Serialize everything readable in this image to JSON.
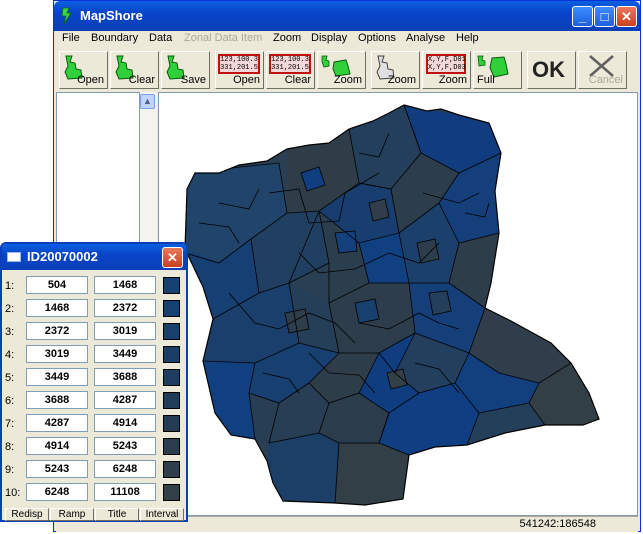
{
  "window": {
    "title": "MapShore"
  },
  "menu": [
    "File",
    "Boundary",
    "Data",
    "Zonal Data Item",
    "Zoom",
    "Display",
    "Options",
    "Analyse",
    "Help"
  ],
  "menu_disabled": [
    "Zonal Data Item"
  ],
  "toolbar": {
    "boundary_open": "Open",
    "boundary_clear": "Clear",
    "boundary_save": "Save",
    "data_open": "Open",
    "data_clear": "Clear",
    "zoom": "Zoom",
    "zoom_out": "Zoom",
    "zoom_xy": "Zoom",
    "full": "Full",
    "ok": "OK",
    "cancel": "Cancel",
    "data_icon_text": [
      "123,100.3",
      "331,201.5"
    ],
    "xy_icon_text": [
      "X,Y,F,D01",
      "X,Y,F,D03"
    ]
  },
  "status": {
    "coordinates": "541242:186548"
  },
  "popup": {
    "title": "ID20070002",
    "rows": [
      {
        "label": "1:",
        "lo": "504",
        "hi": "1468",
        "color": "#163f72"
      },
      {
        "label": "2:",
        "lo": "1468",
        "hi": "2372",
        "color": "#163f72"
      },
      {
        "label": "3:",
        "lo": "2372",
        "hi": "3019",
        "color": "#193f6c"
      },
      {
        "label": "4:",
        "lo": "3019",
        "hi": "3449",
        "color": "#1b3e66"
      },
      {
        "label": "5:",
        "lo": "3449",
        "hi": "3688",
        "color": "#1e3d60"
      },
      {
        "label": "6:",
        "lo": "3688",
        "hi": "4287",
        "color": "#213d5a"
      },
      {
        "label": "7:",
        "lo": "4287",
        "hi": "4914",
        "color": "#243c54"
      },
      {
        "label": "8:",
        "lo": "4914",
        "hi": "5243",
        "color": "#2a3d4e"
      },
      {
        "label": "9:",
        "lo": "5243",
        "hi": "6248",
        "color": "#2e3e4a"
      },
      {
        "label": "10:",
        "lo": "6248",
        "hi": "11108",
        "color": "#323f46"
      }
    ],
    "buttons": [
      "Redisp",
      "Ramp",
      "Title",
      "Interval"
    ]
  },
  "colors": {
    "dark": "#323f46",
    "mid": "#23425f",
    "blue": "#123d7a"
  }
}
